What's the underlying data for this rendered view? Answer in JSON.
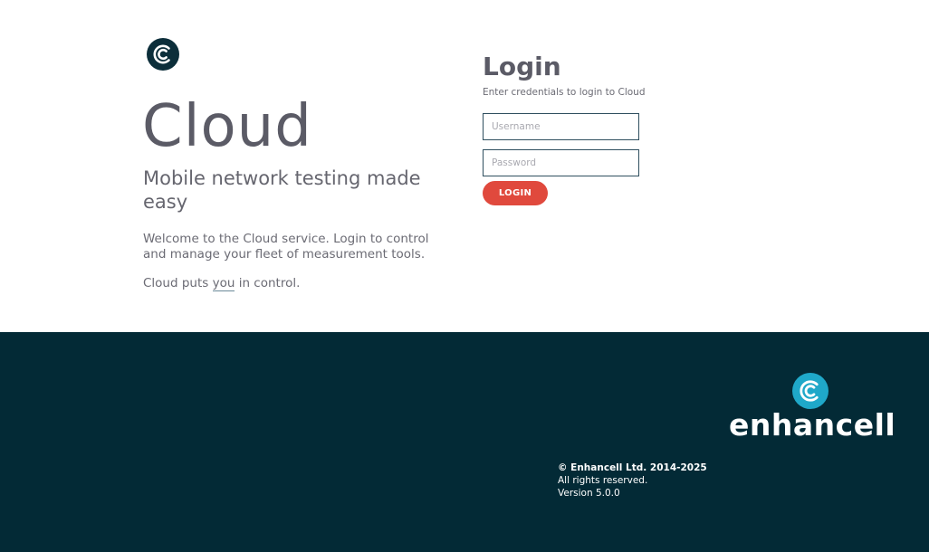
{
  "hero": {
    "title": "Cloud",
    "tagline": "Mobile network testing made easy",
    "welcome": "Welcome to the Cloud service. Login to control and manage your fleet of measurement tools.",
    "puts_prefix": "Cloud puts ",
    "puts_emph": "you",
    "puts_suffix": " in control."
  },
  "login": {
    "title": "Login",
    "subtitle": "Enter credentials to login to Cloud",
    "username_placeholder": "Username",
    "password_placeholder": "Password",
    "button_label": "LOGIN"
  },
  "footer": {
    "brand": "enhancell",
    "copyright": "© Enhancell Ltd. 2014-2025",
    "rights": "All rights reserved.",
    "version": "Version 5.0.0"
  },
  "icons": {
    "logo_small": "enhancell-logo-icon",
    "logo_large": "enhancell-logo-icon"
  },
  "colors": {
    "accent": "#e0493d",
    "footer_bg": "#032a36",
    "logo_dark": "#0c2e3a",
    "logo_light": "#1fa8c9",
    "text": "#5b5b66"
  }
}
